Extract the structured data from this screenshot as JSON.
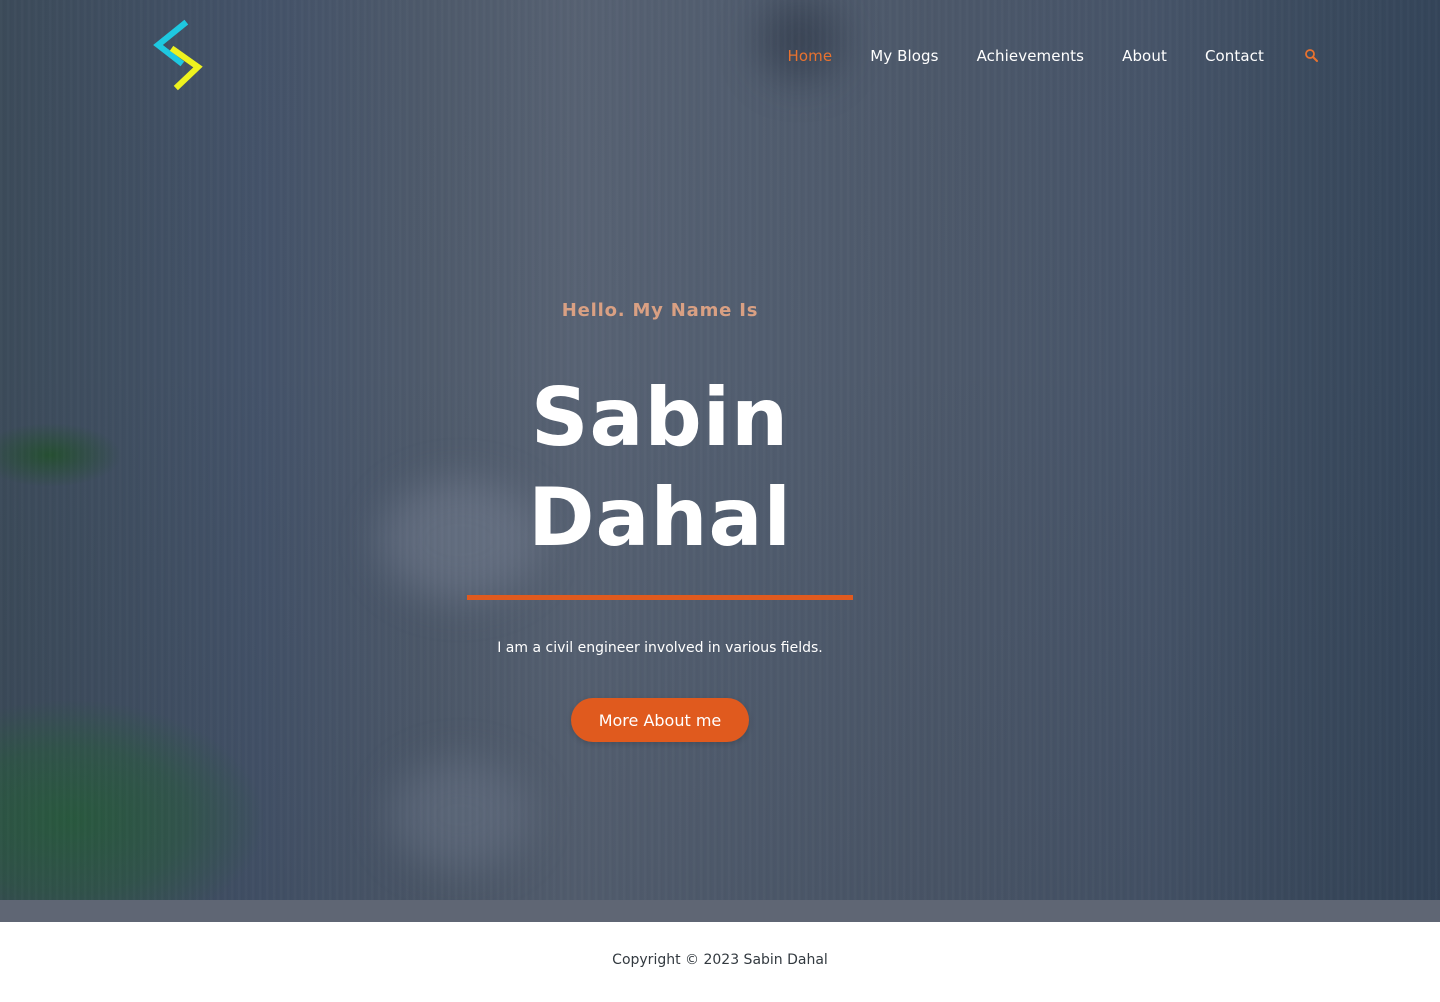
{
  "nav": {
    "items": [
      {
        "label": "Home",
        "active": true
      },
      {
        "label": "My Blogs",
        "active": false
      },
      {
        "label": "Achievements",
        "active": false
      },
      {
        "label": "About",
        "active": false
      },
      {
        "label": "Contact",
        "active": false
      }
    ],
    "search_icon": "search-icon"
  },
  "logo": {
    "icon": "chevron-logo",
    "colors": [
      "#1ec8e0",
      "#eef21e"
    ]
  },
  "hero": {
    "greeting": "Hello. My Name Is",
    "first_name": "Sabin",
    "last_name": "Dahal",
    "tagline": "I am a civil engineer involved in various fields.",
    "cta_label": "More About me"
  },
  "footer": {
    "copyright": "Copyright © 2023 Sabin Dahal"
  },
  "colors": {
    "accent": "#e05a1e",
    "nav_active": "#e8722f",
    "greeting": "#d9a083"
  }
}
